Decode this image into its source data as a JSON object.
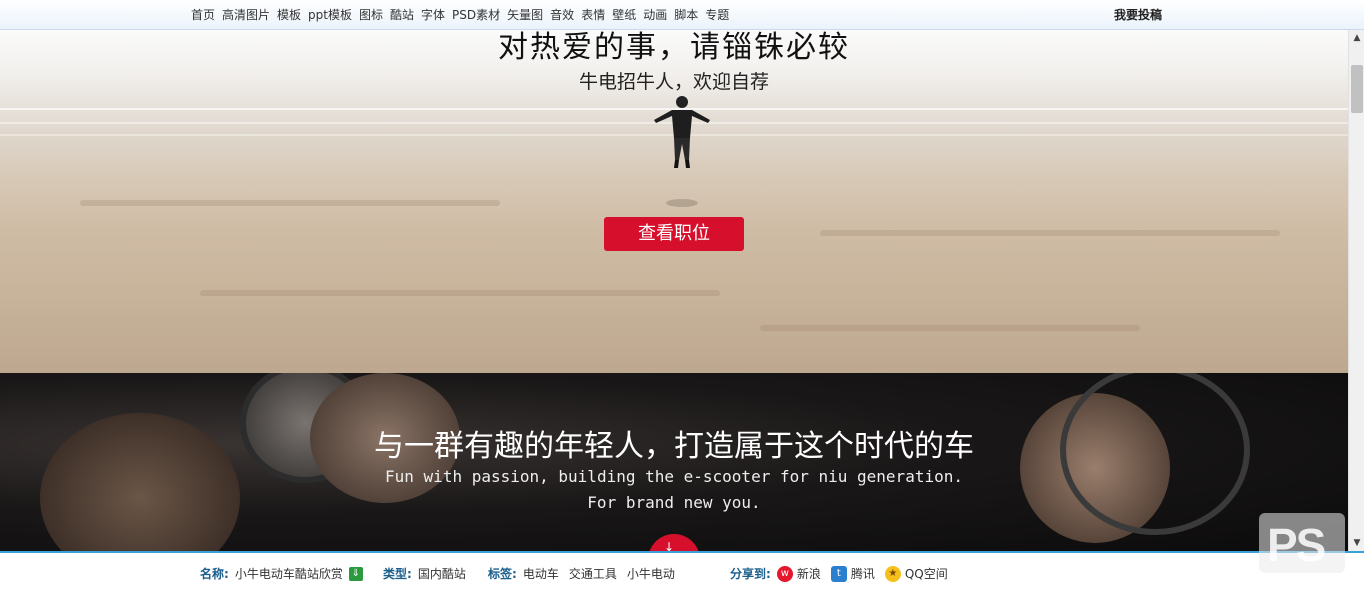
{
  "topnav": {
    "items": [
      "首页",
      "高清图片",
      "模板",
      "ppt模板",
      "图标",
      "酷站",
      "字体",
      "PSD素材",
      "矢量图",
      "音效",
      "表情",
      "壁纸",
      "动画",
      "脚本",
      "专题"
    ],
    "submit_label": "我要投稿"
  },
  "hero": {
    "title": "对热爱的事，请锱铢必较",
    "subtitle": "牛电招牛人，欢迎自荐",
    "button_label": "查看职位"
  },
  "team": {
    "title": "与一群有趣的年轻人，打造属于这个时代的车",
    "english_line1": "Fun with passion, building the e-scooter for niu generation.",
    "english_line2": "For brand new you."
  },
  "footer": {
    "name_label": "名称:",
    "name_value": "小牛电动车酷站欣赏",
    "type_label": "类型:",
    "type_value": "国内酷站",
    "tags_label": "标签:",
    "tags": [
      "电动车",
      "交通工具",
      "小牛电动"
    ],
    "share_label": "分享到:",
    "share_targets": [
      "新浪",
      "腾讯",
      "QQ空间"
    ]
  },
  "watermark_text": "PS",
  "colors": {
    "accent_red": "#d6102c",
    "label_blue": "#1b5f8c",
    "border_blue": "#3aa0d8"
  }
}
